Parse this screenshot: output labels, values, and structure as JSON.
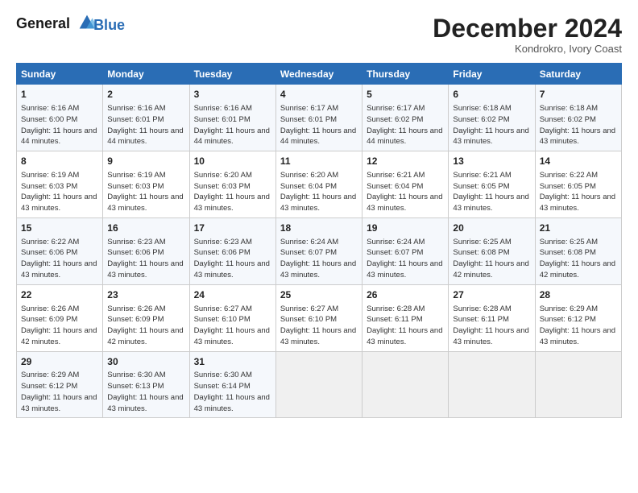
{
  "logo": {
    "line1": "General",
    "line2": "Blue"
  },
  "title": "December 2024",
  "subtitle": "Kondrokro, Ivory Coast",
  "days_of_week": [
    "Sunday",
    "Monday",
    "Tuesday",
    "Wednesday",
    "Thursday",
    "Friday",
    "Saturday"
  ],
  "weeks": [
    [
      {
        "day": "1",
        "info": "Sunrise: 6:16 AM\nSunset: 6:00 PM\nDaylight: 11 hours and 44 minutes."
      },
      {
        "day": "2",
        "info": "Sunrise: 6:16 AM\nSunset: 6:01 PM\nDaylight: 11 hours and 44 minutes."
      },
      {
        "day": "3",
        "info": "Sunrise: 6:16 AM\nSunset: 6:01 PM\nDaylight: 11 hours and 44 minutes."
      },
      {
        "day": "4",
        "info": "Sunrise: 6:17 AM\nSunset: 6:01 PM\nDaylight: 11 hours and 44 minutes."
      },
      {
        "day": "5",
        "info": "Sunrise: 6:17 AM\nSunset: 6:02 PM\nDaylight: 11 hours and 44 minutes."
      },
      {
        "day": "6",
        "info": "Sunrise: 6:18 AM\nSunset: 6:02 PM\nDaylight: 11 hours and 43 minutes."
      },
      {
        "day": "7",
        "info": "Sunrise: 6:18 AM\nSunset: 6:02 PM\nDaylight: 11 hours and 43 minutes."
      }
    ],
    [
      {
        "day": "8",
        "info": "Sunrise: 6:19 AM\nSunset: 6:03 PM\nDaylight: 11 hours and 43 minutes."
      },
      {
        "day": "9",
        "info": "Sunrise: 6:19 AM\nSunset: 6:03 PM\nDaylight: 11 hours and 43 minutes."
      },
      {
        "day": "10",
        "info": "Sunrise: 6:20 AM\nSunset: 6:03 PM\nDaylight: 11 hours and 43 minutes."
      },
      {
        "day": "11",
        "info": "Sunrise: 6:20 AM\nSunset: 6:04 PM\nDaylight: 11 hours and 43 minutes."
      },
      {
        "day": "12",
        "info": "Sunrise: 6:21 AM\nSunset: 6:04 PM\nDaylight: 11 hours and 43 minutes."
      },
      {
        "day": "13",
        "info": "Sunrise: 6:21 AM\nSunset: 6:05 PM\nDaylight: 11 hours and 43 minutes."
      },
      {
        "day": "14",
        "info": "Sunrise: 6:22 AM\nSunset: 6:05 PM\nDaylight: 11 hours and 43 minutes."
      }
    ],
    [
      {
        "day": "15",
        "info": "Sunrise: 6:22 AM\nSunset: 6:06 PM\nDaylight: 11 hours and 43 minutes."
      },
      {
        "day": "16",
        "info": "Sunrise: 6:23 AM\nSunset: 6:06 PM\nDaylight: 11 hours and 43 minutes."
      },
      {
        "day": "17",
        "info": "Sunrise: 6:23 AM\nSunset: 6:06 PM\nDaylight: 11 hours and 43 minutes."
      },
      {
        "day": "18",
        "info": "Sunrise: 6:24 AM\nSunset: 6:07 PM\nDaylight: 11 hours and 43 minutes."
      },
      {
        "day": "19",
        "info": "Sunrise: 6:24 AM\nSunset: 6:07 PM\nDaylight: 11 hours and 43 minutes."
      },
      {
        "day": "20",
        "info": "Sunrise: 6:25 AM\nSunset: 6:08 PM\nDaylight: 11 hours and 42 minutes."
      },
      {
        "day": "21",
        "info": "Sunrise: 6:25 AM\nSunset: 6:08 PM\nDaylight: 11 hours and 42 minutes."
      }
    ],
    [
      {
        "day": "22",
        "info": "Sunrise: 6:26 AM\nSunset: 6:09 PM\nDaylight: 11 hours and 42 minutes."
      },
      {
        "day": "23",
        "info": "Sunrise: 6:26 AM\nSunset: 6:09 PM\nDaylight: 11 hours and 42 minutes."
      },
      {
        "day": "24",
        "info": "Sunrise: 6:27 AM\nSunset: 6:10 PM\nDaylight: 11 hours and 43 minutes."
      },
      {
        "day": "25",
        "info": "Sunrise: 6:27 AM\nSunset: 6:10 PM\nDaylight: 11 hours and 43 minutes."
      },
      {
        "day": "26",
        "info": "Sunrise: 6:28 AM\nSunset: 6:11 PM\nDaylight: 11 hours and 43 minutes."
      },
      {
        "day": "27",
        "info": "Sunrise: 6:28 AM\nSunset: 6:11 PM\nDaylight: 11 hours and 43 minutes."
      },
      {
        "day": "28",
        "info": "Sunrise: 6:29 AM\nSunset: 6:12 PM\nDaylight: 11 hours and 43 minutes."
      }
    ],
    [
      {
        "day": "29",
        "info": "Sunrise: 6:29 AM\nSunset: 6:12 PM\nDaylight: 11 hours and 43 minutes."
      },
      {
        "day": "30",
        "info": "Sunrise: 6:30 AM\nSunset: 6:13 PM\nDaylight: 11 hours and 43 minutes."
      },
      {
        "day": "31",
        "info": "Sunrise: 6:30 AM\nSunset: 6:14 PM\nDaylight: 11 hours and 43 minutes."
      },
      null,
      null,
      null,
      null
    ]
  ]
}
